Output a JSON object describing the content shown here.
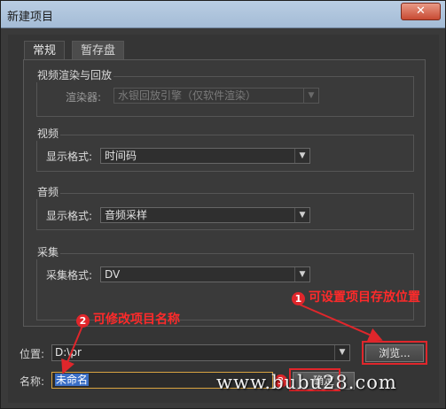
{
  "window": {
    "title": "新建项目",
    "close_glyph": "✕"
  },
  "tabs": [
    {
      "label": "常规",
      "active": true
    },
    {
      "label": "暂存盘",
      "active": false
    }
  ],
  "groups": {
    "video_rendering": {
      "label": "视频渲染与回放",
      "field_label": "渲染器:",
      "value": "水银回放引擎（仅软件渲染）",
      "enabled": false
    },
    "video": {
      "label": "视频",
      "field_label": "显示格式:",
      "value": "时间码"
    },
    "audio": {
      "label": "音频",
      "field_label": "显示格式:",
      "value": "音频采样"
    },
    "capture": {
      "label": "采集",
      "field_label": "采集格式:",
      "value": "DV"
    }
  },
  "location": {
    "label": "位置:",
    "value": "D:\\pr",
    "browse_label": "浏览..."
  },
  "name": {
    "label": "名称:",
    "value": "未命名"
  },
  "ok_button": {
    "label": "确定"
  },
  "annotations": [
    {
      "num": "1",
      "text": "可设置项目存放位置"
    },
    {
      "num": "2",
      "text": "可修改项目名称"
    }
  ],
  "hidden_marker": "3",
  "watermark": "www.bubu28.com",
  "colors": {
    "annotation_red": "#e0262b",
    "focus_border": "#d9a441",
    "selection_blue": "#3b6fc6"
  }
}
